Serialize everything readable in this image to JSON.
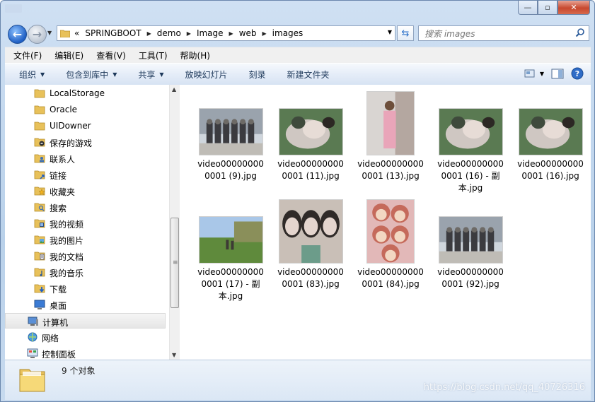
{
  "window": {
    "controls": {
      "minimize": "—",
      "maximize": "▫",
      "close": "✕"
    }
  },
  "nav": {
    "back_icon": "back-arrow-icon",
    "forward_icon": "forward-arrow-icon",
    "breadcrumb_prefix": "«",
    "breadcrumb": [
      "SPRINGBOOT",
      "demo",
      "Image",
      "web",
      "images"
    ],
    "search_placeholder": "搜索 images"
  },
  "menubar": [
    "文件(F)",
    "编辑(E)",
    "查看(V)",
    "工具(T)",
    "帮助(H)"
  ],
  "toolbar": {
    "organize": "组织",
    "include_in_library": "包含到库中",
    "share": "共享",
    "slideshow": "放映幻灯片",
    "burn": "刻录",
    "new_folder": "新建文件夹"
  },
  "sidebar": {
    "items": [
      {
        "label": "LocalStorage",
        "icon": "folder-icon"
      },
      {
        "label": "Oracle",
        "icon": "folder-icon"
      },
      {
        "label": "UIDowner",
        "icon": "folder-icon"
      },
      {
        "label": "保存的游戏",
        "icon": "saved-games-icon"
      },
      {
        "label": "联系人",
        "icon": "contacts-icon"
      },
      {
        "label": "链接",
        "icon": "links-icon"
      },
      {
        "label": "收藏夹",
        "icon": "favorites-icon"
      },
      {
        "label": "搜索",
        "icon": "searches-icon"
      },
      {
        "label": "我的视频",
        "icon": "videos-icon"
      },
      {
        "label": "我的图片",
        "icon": "pictures-icon"
      },
      {
        "label": "我的文档",
        "icon": "documents-icon"
      },
      {
        "label": "我的音乐",
        "icon": "music-icon"
      },
      {
        "label": "下载",
        "icon": "downloads-icon"
      },
      {
        "label": "桌面",
        "icon": "desktop-icon"
      },
      {
        "label": "计算机",
        "icon": "computer-icon"
      },
      {
        "label": "网络",
        "icon": "network-icon"
      },
      {
        "label": "控制面板",
        "icon": "control-panel-icon"
      }
    ]
  },
  "files": [
    {
      "line1": "video00000000",
      "line2": "0001 (9).jpg",
      "line3": ""
    },
    {
      "line1": "video00000000",
      "line2": "0001 (11).jpg",
      "line3": ""
    },
    {
      "line1": "video00000000",
      "line2": "0001 (13).jpg",
      "line3": ""
    },
    {
      "line1": "video00000000",
      "line2": "0001 (16) - 副",
      "line3": "本.jpg"
    },
    {
      "line1": "video00000000",
      "line2": "0001 (16).jpg",
      "line3": ""
    },
    {
      "line1": "video00000000",
      "line2": "0001 (17) - 副",
      "line3": "本.jpg"
    },
    {
      "line1": "video00000000",
      "line2": "0001 (83).jpg",
      "line3": ""
    },
    {
      "line1": "video00000000",
      "line2": "0001 (84).jpg",
      "line3": ""
    },
    {
      "line1": "video00000000",
      "line2": "0001 (92).jpg",
      "line3": ""
    }
  ],
  "status": {
    "count": "9 个对象"
  },
  "watermark": "https://blog.csdn.net/qq_40726316",
  "colors": {
    "accent": "#2a6fc9",
    "chrome": "#c7daef"
  }
}
